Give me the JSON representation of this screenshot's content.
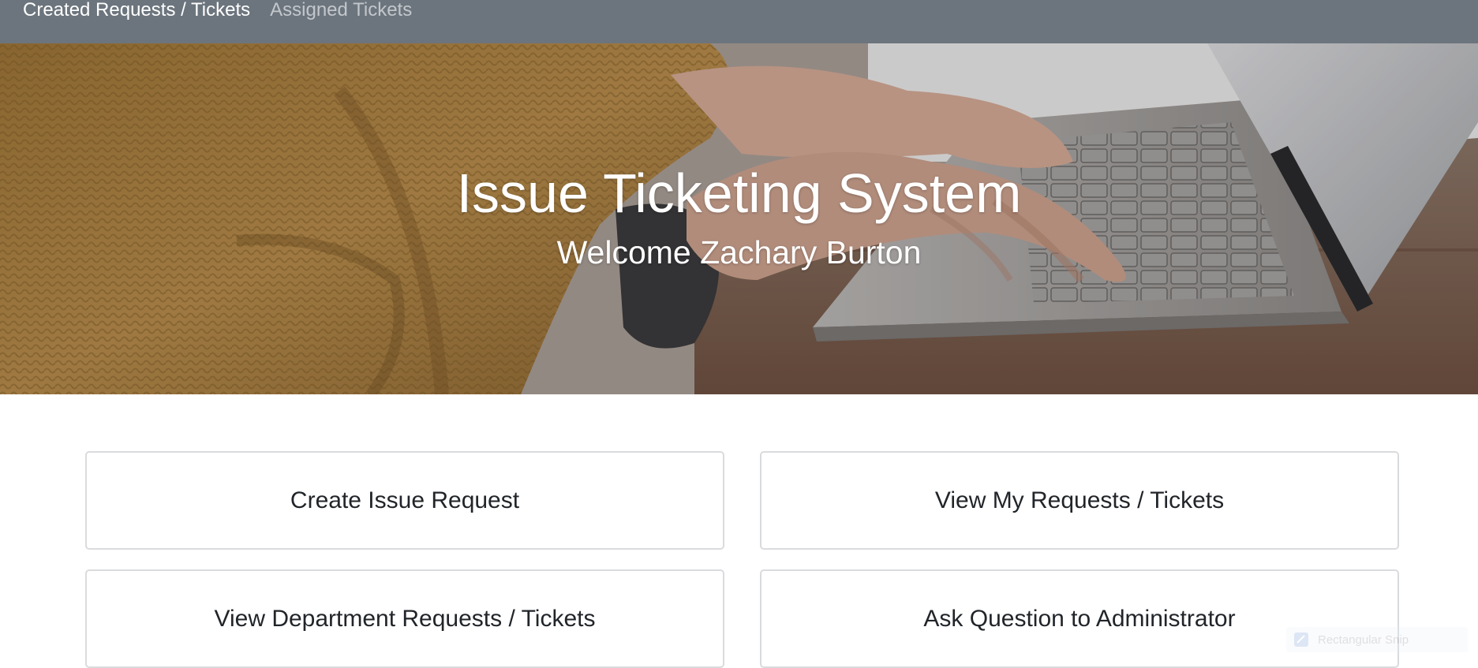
{
  "nav": {
    "created_label": "Created Requests / Tickets",
    "assigned_label": "Assigned Tickets",
    "bar_color": "#6c757d"
  },
  "hero": {
    "title": "Issue Ticketing System",
    "subtitle": "Welcome Zachary Burton",
    "image": "hands typing on laptop keyboard, mustard sweater, wooden desk"
  },
  "actions": [
    {
      "label": "Create Issue Request"
    },
    {
      "label": "View My Requests / Tickets"
    },
    {
      "label": "View Department Requests / Tickets"
    },
    {
      "label": "Ask Question to Administrator"
    }
  ],
  "overlay": {
    "snip_label": "Rectangular Snip",
    "icon": "snip-tool-icon"
  }
}
